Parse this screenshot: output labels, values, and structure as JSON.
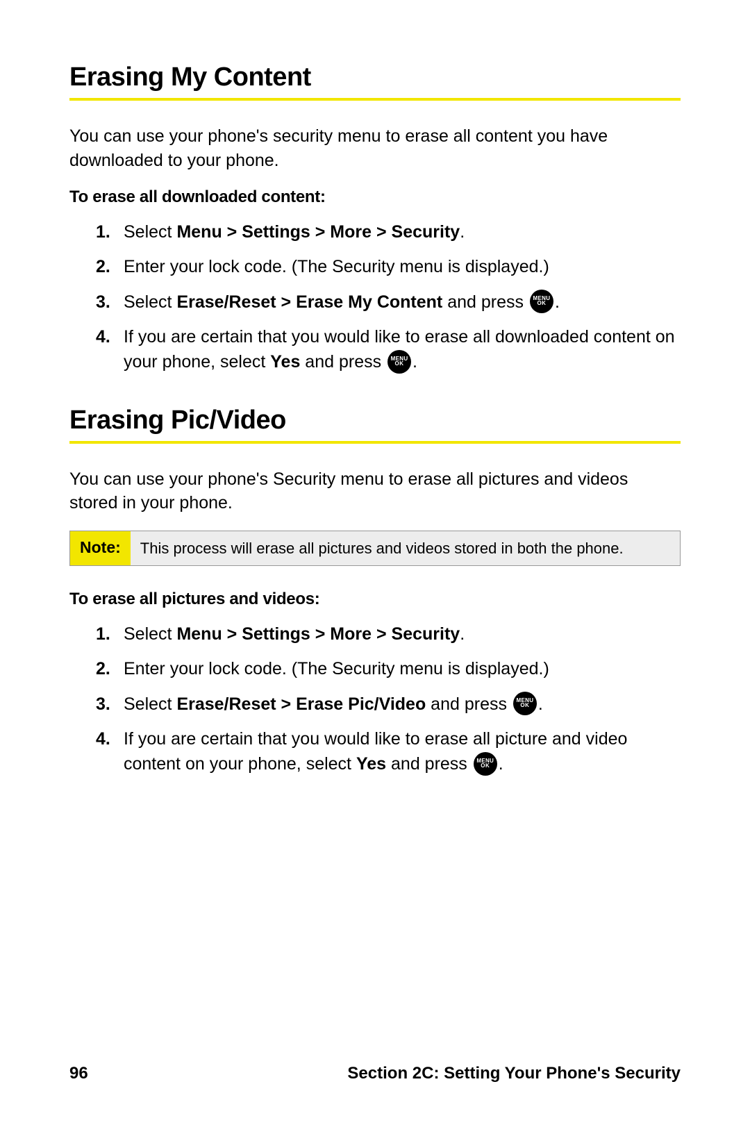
{
  "section1": {
    "heading": "Erasing My Content",
    "intro": "You can use your phone's security menu to erase all content you have downloaded to your phone.",
    "subhead": "To erase all downloaded content:",
    "steps": {
      "s1a": "Select ",
      "s1b": "Menu > Settings > More > Security",
      "s1c": ".",
      "s2": "Enter your lock code. (The Security menu is displayed.)",
      "s3a": "Select ",
      "s3b": "Erase/Reset > Erase My Content",
      "s3c": " and press ",
      "s3d": ".",
      "s4a": "If you are certain that you would like to erase all downloaded content on your phone, select ",
      "s4b": "Yes",
      "s4c": " and press ",
      "s4d": "."
    }
  },
  "section2": {
    "heading": "Erasing Pic/Video",
    "intro": "You can use your phone's Security menu to erase all pictures and videos stored in your phone.",
    "note_label": "Note:",
    "note_text": "This process will erase all pictures and videos stored in both the phone.",
    "subhead": "To erase all pictures and videos:",
    "steps": {
      "s1a": "Select ",
      "s1b": "Menu > Settings > More > Security",
      "s1c": ".",
      "s2": "Enter your lock code. (The Security menu is displayed.)",
      "s3a": "Select ",
      "s3b": "Erase/Reset > Erase Pic/Video",
      "s3c": " and press ",
      "s3d": ".",
      "s4a": "If you are certain that you would like to erase all picture and video content on your phone, select ",
      "s4b": "Yes",
      "s4c": " and press ",
      "s4d": "."
    }
  },
  "button": {
    "line1": "MENU",
    "line2": "OK"
  },
  "footer": {
    "page": "96",
    "title": "Section 2C: Setting Your Phone's Security"
  }
}
